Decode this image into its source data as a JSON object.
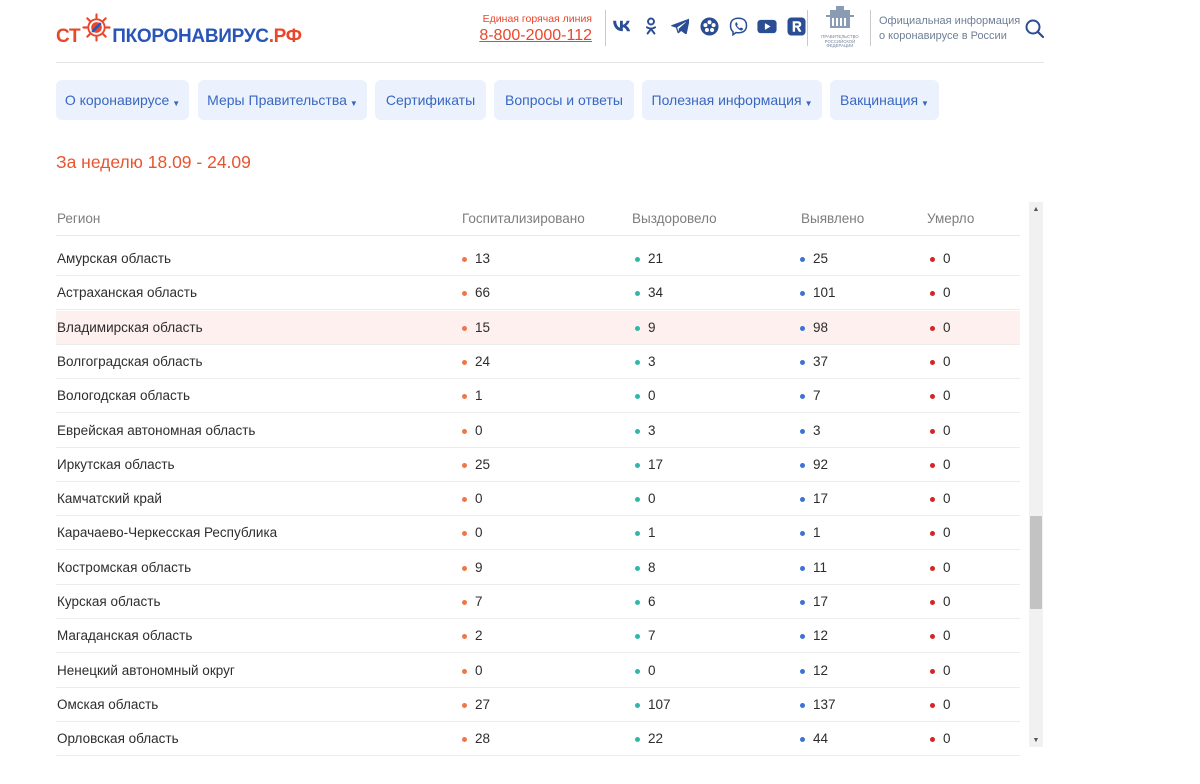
{
  "colors": {
    "accent": "#e8472b",
    "nav_bg": "#ebf2fd",
    "nav_text": "#3967c0",
    "dot_hospitalized": "#f0764a",
    "dot_recovered": "#2db8a9",
    "dot_detected": "#3f72d6",
    "dot_died": "#d52424",
    "row_highlight": "#fdf0ef"
  },
  "header": {
    "logo": {
      "part1": "СТ",
      "part2": "ПКОРОНАВИРУС",
      "part3": ".РФ",
      "icon": "virus-icon"
    },
    "hotline": {
      "label": "Единая горячая линия",
      "phone": "8-800-2000-112"
    },
    "social_icons": [
      "vk-icon",
      "odnoklassniki-icon",
      "telegram-icon",
      "rutube-icon",
      "viber-icon",
      "youtube-icon",
      "rambler-icon"
    ],
    "gov_emblem": {
      "icon": "government-building-icon",
      "line1": "ПРАВИТЕЛЬСТВО",
      "line2": "РОССИЙСКОЙ",
      "line3": "ФЕДЕРАЦИИ"
    },
    "official_line1": "Официальная информация",
    "official_line2": "о коронавирусе в России",
    "search_icon": "search-icon"
  },
  "nav": [
    {
      "label": "О коронавирусе",
      "has_dropdown": true
    },
    {
      "label": "Меры Правительства",
      "has_dropdown": true
    },
    {
      "label": "Сертификаты",
      "has_dropdown": false
    },
    {
      "label": "Вопросы и ответы",
      "has_dropdown": false
    },
    {
      "label": "Полезная информация",
      "has_dropdown": true
    },
    {
      "label": "Вакцинация",
      "has_dropdown": true
    }
  ],
  "caret": "▼",
  "week_title": "За неделю 18.09 - 24.09",
  "table": {
    "columns": [
      "Регион",
      "Госпитализировано",
      "Выздоровело",
      "Выявлено",
      "Умерло"
    ],
    "highlighted_row": 2,
    "rows": [
      {
        "region": "Амурская область",
        "hospitalized": "13",
        "recovered": "21",
        "detected": "25",
        "died": "0"
      },
      {
        "region": "Астраханская область",
        "hospitalized": "66",
        "recovered": "34",
        "detected": "101",
        "died": "0"
      },
      {
        "region": "Владимирская область",
        "hospitalized": "15",
        "recovered": "9",
        "detected": "98",
        "died": "0"
      },
      {
        "region": "Волгоградская область",
        "hospitalized": "24",
        "recovered": "3",
        "detected": "37",
        "died": "0"
      },
      {
        "region": "Вологодская область",
        "hospitalized": "1",
        "recovered": "0",
        "detected": "7",
        "died": "0"
      },
      {
        "region": "Еврейская автономная область",
        "hospitalized": "0",
        "recovered": "3",
        "detected": "3",
        "died": "0"
      },
      {
        "region": "Иркутская область",
        "hospitalized": "25",
        "recovered": "17",
        "detected": "92",
        "died": "0"
      },
      {
        "region": "Камчатский край",
        "hospitalized": "0",
        "recovered": "0",
        "detected": "17",
        "died": "0"
      },
      {
        "region": "Карачаево-Черкесская Республика",
        "hospitalized": "0",
        "recovered": "1",
        "detected": "1",
        "died": "0"
      },
      {
        "region": "Костромская область",
        "hospitalized": "9",
        "recovered": "8",
        "detected": "11",
        "died": "0"
      },
      {
        "region": "Курская область",
        "hospitalized": "7",
        "recovered": "6",
        "detected": "17",
        "died": "0"
      },
      {
        "region": "Магаданская область",
        "hospitalized": "2",
        "recovered": "7",
        "detected": "12",
        "died": "0"
      },
      {
        "region": "Ненецкий автономный округ",
        "hospitalized": "0",
        "recovered": "0",
        "detected": "12",
        "died": "0"
      },
      {
        "region": "Омская область",
        "hospitalized": "27",
        "recovered": "107",
        "detected": "137",
        "died": "0"
      },
      {
        "region": "Орловская область",
        "hospitalized": "28",
        "recovered": "22",
        "detected": "44",
        "died": "0"
      }
    ]
  },
  "scrollbar": {
    "up_icon": "arrow-up-icon",
    "down_icon": "arrow-down-icon",
    "up_glyph": "▲",
    "down_glyph": "▼"
  }
}
